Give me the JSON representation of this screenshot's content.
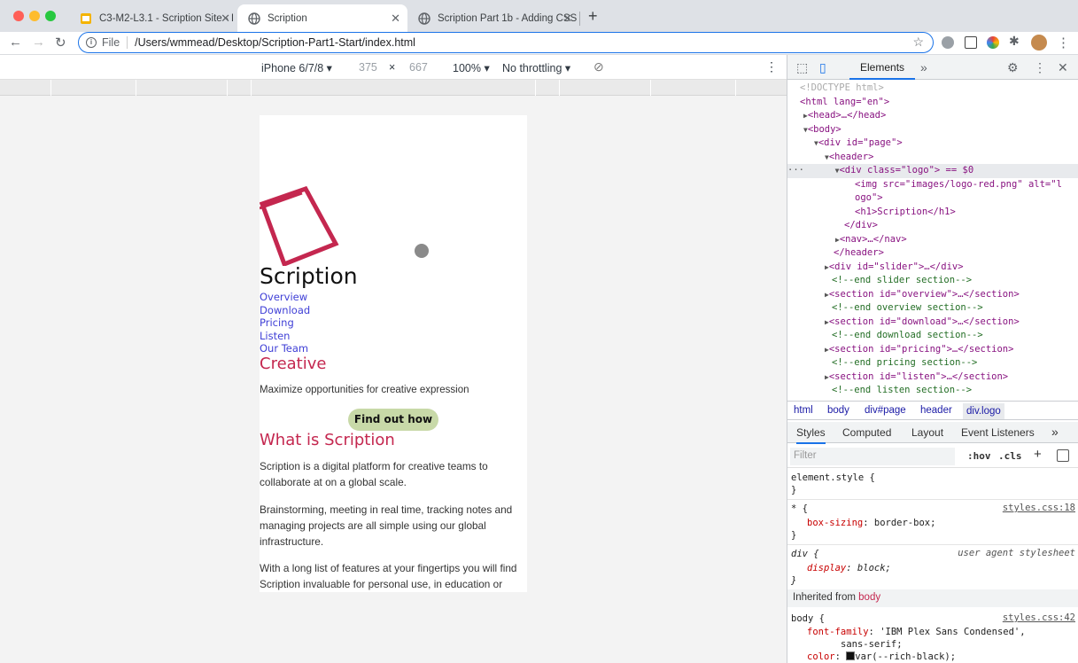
{
  "tabs": [
    {
      "title": "C3-M2-L3.1 - Scription Site - I",
      "icon": "slides-icon",
      "active": false
    },
    {
      "title": "Scription",
      "icon": "globe-icon",
      "active": true
    },
    {
      "title": "Scription Part 1b - Adding CSS",
      "icon": "globe-icon",
      "active": false
    }
  ],
  "omnibox": {
    "scheme_label": "File",
    "url": "/Users/wmmead/Desktop/Scription-Part1-Start/index.html"
  },
  "device_toolbar": {
    "device": "iPhone 6/7/8",
    "width": "375",
    "times": "×",
    "height": "667",
    "zoom": "100%",
    "throttle": "No throttling"
  },
  "site": {
    "title": "Scription",
    "nav": [
      "Overview",
      "Download",
      "Pricing",
      "Listen",
      "Our Team"
    ],
    "creative_heading": "Creative",
    "tagline": "Maximize opportunities for creative expression",
    "cta": "Find out how",
    "what_heading": "What is Scription",
    "paragraphs": [
      "Scription is a digital platform for creative teams to collaborate at on a global scale.",
      "Brainstorming, meeting in real time, tracking notes and managing projects are all simple using our global infrastructure.",
      "With a long list of features at your fingertips you will find Scription invaluable for personal use, in education or"
    ]
  },
  "devtools": {
    "tab": "Elements",
    "dom": {
      "doctype": "<!DOCTYPE html>",
      "html_open": "<html lang=\"en\">",
      "head": "<head>…</head>",
      "body_open": "<body>",
      "page_div": "<div id=\"page\">",
      "header_open": "<header>",
      "logo_div": "<div class=\"logo\"> == $0",
      "img_line1": "<img src=\"images/logo-red.png\" alt=\"l",
      "img_line2": "ogo\">",
      "h1": "<h1>Scription</h1>",
      "div_close": "</div>",
      "nav": "<nav>…</nav>",
      "header_close": "</header>",
      "slider": "<div id=\"slider\">…</div>",
      "c_slider": "<!--end slider section-->",
      "overview": "<section id=\"overview\">…</section>",
      "c_overview": "<!--end overview section-->",
      "download": "<section id=\"download\">…</section>",
      "c_download": "<!--end download section-->",
      "pricing": "<section id=\"pricing\">…</section>",
      "c_pricing": "<!--end pricing section-->",
      "listen": "<section id=\"listen\">…</section>",
      "c_listen": "<!--end listen section-->"
    },
    "breadcrumbs": [
      "html",
      "body",
      "div#page",
      "header",
      "div.logo"
    ],
    "subtabs": [
      "Styles",
      "Computed",
      "Layout",
      "Event Listeners"
    ],
    "filter_placeholder": "Filter",
    "hov": ":hov",
    "cls": ".cls",
    "styles": {
      "element_style": "element.style {",
      "close": "}",
      "star_sel": "* {",
      "star_src": "styles.css:18",
      "box_sizing_prop": "box-sizing",
      "box_sizing_val": "border-box;",
      "div_sel": "div {",
      "div_src": "user agent stylesheet",
      "display_prop": "display",
      "display_val": "block;",
      "inherited_label": "Inherited from",
      "inherited_el": "body",
      "body_sel": "body {",
      "body_src": "styles.css:42",
      "ff_prop": "font-family",
      "ff_val": "'IBM Plex Sans Condensed',",
      "ff_val2": "sans-serif;",
      "color_prop": "color",
      "color_val": "var(--rich-black);"
    }
  },
  "colors": {
    "accent": "#c4274f",
    "link": "#3f3fd6",
    "cta_bg": "#c8d9a8",
    "focus": "#1a73e8"
  }
}
